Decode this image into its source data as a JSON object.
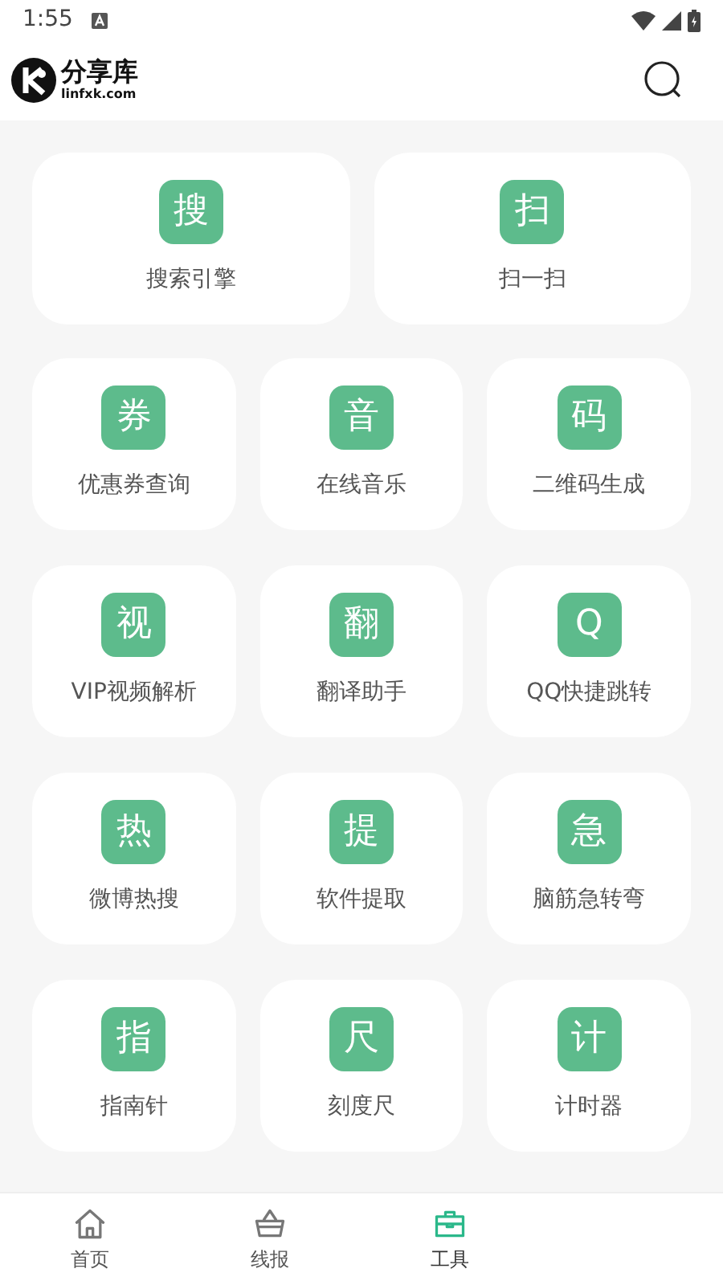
{
  "status_bar": {
    "time": "1:55"
  },
  "header": {
    "logo_text": "分享库",
    "logo_domain": "linfxk.com"
  },
  "featured_tools": [
    {
      "glyph": "搜",
      "label": "搜索引擎"
    },
    {
      "glyph": "扫",
      "label": "扫一扫"
    }
  ],
  "tools": [
    {
      "glyph": "券",
      "label": "优惠券查询"
    },
    {
      "glyph": "音",
      "label": "在线音乐"
    },
    {
      "glyph": "码",
      "label": "二维码生成"
    },
    {
      "glyph": "视",
      "label": "VIP视频解析"
    },
    {
      "glyph": "翻",
      "label": "翻译助手"
    },
    {
      "glyph": "Q",
      "label": "QQ快捷跳转"
    },
    {
      "glyph": "热",
      "label": "微博热搜"
    },
    {
      "glyph": "提",
      "label": "软件提取"
    },
    {
      "glyph": "急",
      "label": "脑筋急转弯"
    },
    {
      "glyph": "指",
      "label": "指南针"
    },
    {
      "glyph": "尺",
      "label": "刻度尺"
    },
    {
      "glyph": "计",
      "label": "计时器"
    }
  ],
  "bottom_nav": [
    {
      "kind": "home",
      "label": "首页",
      "selected": false
    },
    {
      "kind": "basket",
      "label": "线报",
      "selected": false
    },
    {
      "kind": "toolbox",
      "label": "工具",
      "selected": true
    }
  ]
}
